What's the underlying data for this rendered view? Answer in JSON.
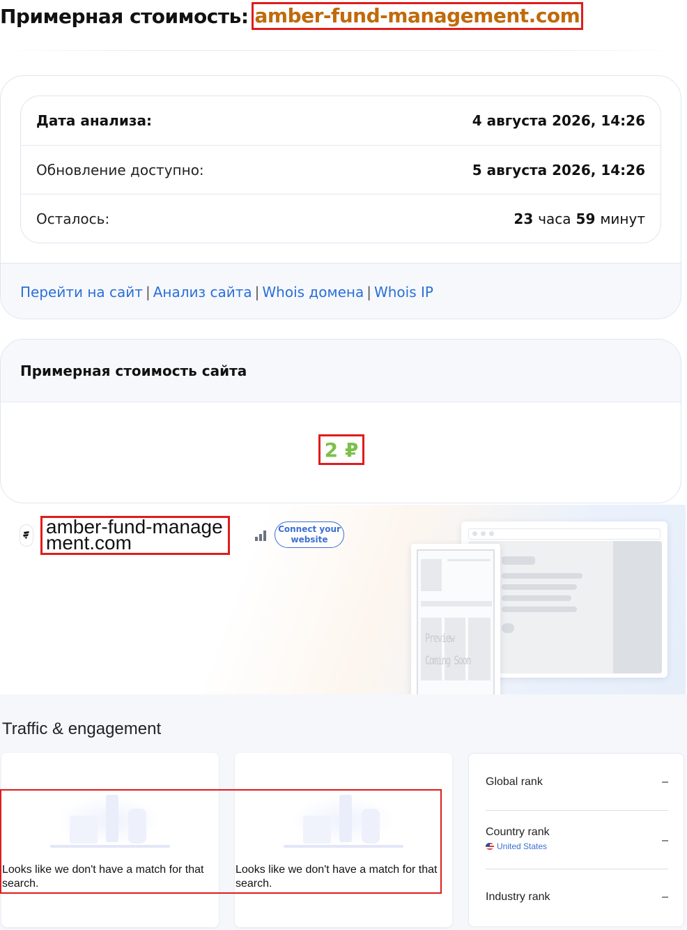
{
  "header": {
    "title_prefix": "Примерная стоимость:",
    "domain": "amber-fund-management.com"
  },
  "analysis": {
    "rows": [
      {
        "label": "Дата анализа:",
        "value": "4 августа 2026, 14:26"
      },
      {
        "label": "Обновление доступно:",
        "value": "5 августа 2026, 14:26"
      },
      {
        "label": "Осталось:",
        "hours": "23",
        "hours_unit": "часа",
        "minutes": "59",
        "minutes_unit": "минут"
      }
    ],
    "links": [
      "Перейти на сайт",
      "Анализ сайта",
      "Whois домена",
      "Whois IP"
    ],
    "separator": "|"
  },
  "valuation": {
    "heading": "Примерная стоимость сайта",
    "price": "2 ₽"
  },
  "similarweb": {
    "logo_icon": "similarweb-logo-icon",
    "domain": "amber-fund-management.com",
    "rank_icon": "bar-chart-icon",
    "connect_label": "Connect your website",
    "preview_line1": "Preview",
    "preview_line2": "Coming Soon"
  },
  "traffic": {
    "title": "Traffic & engagement",
    "empty_message": "Looks like we don't have a match for that search.",
    "ranks": [
      {
        "label": "Global rank",
        "value": "–"
      },
      {
        "label": "Country rank",
        "country": "United States",
        "value": "–"
      },
      {
        "label": "Industry rank",
        "value": "–"
      }
    ]
  },
  "colors": {
    "domain_orange": "#c06a0b",
    "highlight_red": "#e01b1b",
    "link_blue": "#2a6fd6",
    "price_green": "#7cc04b"
  }
}
